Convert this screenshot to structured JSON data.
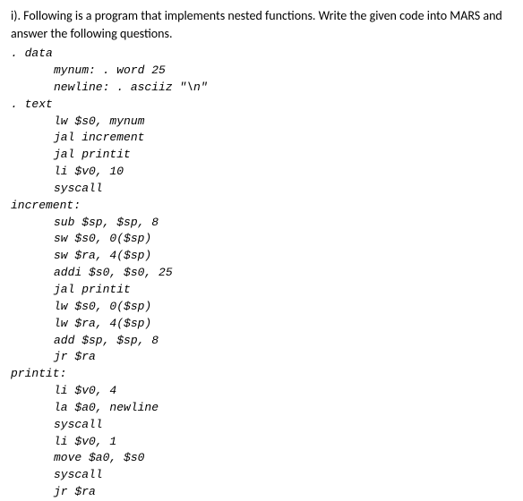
{
  "question": {
    "text": "i). Following is a program that implements nested functions. Write the given code into MARS and answer the following questions."
  },
  "code": {
    "data_section": ". data",
    "mynum": "mynum: . word 25",
    "newline": "newline: . asciiz \"\\n\"",
    "text_section": ". text",
    "main": {
      "l1": "lw $s0, mynum",
      "l2": "jal increment",
      "l3": "jal printit",
      "l4": "li $v0, 10",
      "l5": "syscall"
    },
    "increment_label": "increment:",
    "increment": {
      "l1": "sub $sp, $sp, 8",
      "l2": "sw $s0, 0($sp)",
      "l3": "sw $ra, 4($sp)",
      "l4": "addi $s0, $s0, 25",
      "l5": "jal printit",
      "l6": "lw $s0, 0($sp)",
      "l7": "lw $ra, 4($sp)",
      "l8": "add $sp, $sp, 8",
      "l9": "jr $ra"
    },
    "printit_label": "printit:",
    "printit": {
      "l1": "li $v0, 4",
      "l2": "la $a0, newline",
      "l3": "syscall",
      "l4": "li $v0, 1",
      "l5": "move $a0, $s0",
      "l6": "syscall",
      "l7": "jr $ra"
    }
  }
}
